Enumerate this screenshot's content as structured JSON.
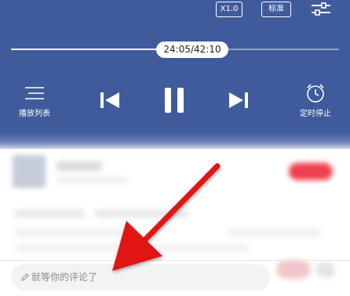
{
  "player": {
    "speed_label": "X1.0",
    "quality_label": "标准",
    "settings_icon": "sliders-icon",
    "progress": {
      "time_text": "24:05/42:10",
      "fraction": 0.571
    },
    "controls": {
      "playlist_icon": "playlist-icon",
      "playlist_label": "播放列表",
      "prev_icon": "skip-previous-icon",
      "pause_icon": "pause-icon",
      "next_icon": "skip-next-icon",
      "timer_icon": "alarm-clock-icon",
      "timer_label": "定时停止"
    }
  },
  "comment": {
    "icon": "pen-icon",
    "placeholder": "就等你的评论了"
  },
  "overlay": {
    "annotation_icon": "red-arrow-icon",
    "arrow_color": "#e01212"
  },
  "colors": {
    "player_bg": "#3f5b9c",
    "accent_red": "#ef3f4f"
  }
}
